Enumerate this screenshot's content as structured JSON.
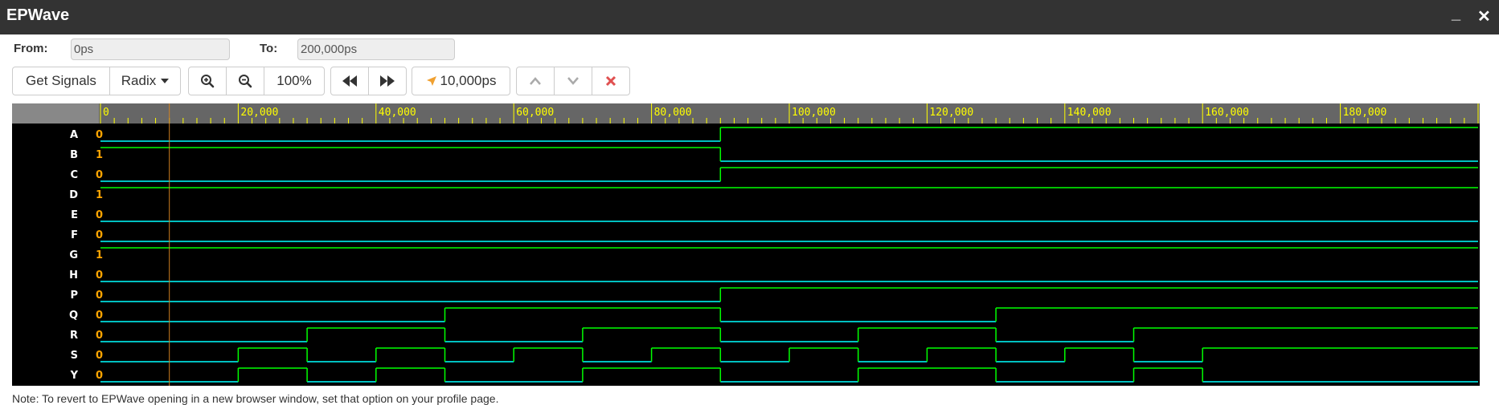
{
  "window": {
    "title": "EPWave",
    "minimize": "_",
    "close": "✕"
  },
  "range": {
    "from_label": "From:",
    "from_value": "0ps",
    "to_label": "To:",
    "to_value": "200,000ps"
  },
  "toolbar": {
    "get_signals": "Get Signals",
    "radix": "Radix",
    "zoom_level": "100%",
    "cursor_time": "10,000ps",
    "icons": [
      "zoom-in-icon",
      "zoom-out-icon",
      "rewind-icon",
      "fast-forward-icon",
      "cursor-arrow-icon",
      "chevron-up-icon",
      "chevron-down-icon",
      "remove-icon"
    ],
    "colors": {
      "cursor_arrow": "#f0a030",
      "remove": "#e05050"
    }
  },
  "timeline": {
    "total_ps": 200000,
    "labels": [
      "0",
      "20,000",
      "40,000",
      "60,000",
      "80,000",
      "100,000",
      "120,000",
      "140,000",
      "160,000",
      "180,000"
    ],
    "cursor_ps": 10000,
    "colors": {
      "ruler_bg": "#666666",
      "ruler_text": "#ffff00",
      "cursor": "#d08020",
      "wave": "#00ff00",
      "wave_low": "#00ffff"
    }
  },
  "signals": [
    {
      "name": "A",
      "value": "0",
      "wave": [
        [
          0,
          0
        ],
        [
          90000,
          1
        ]
      ]
    },
    {
      "name": "B",
      "value": "1",
      "wave": [
        [
          0,
          1
        ],
        [
          90000,
          0
        ]
      ]
    },
    {
      "name": "C",
      "value": "0",
      "wave": [
        [
          0,
          0
        ],
        [
          90000,
          1
        ]
      ]
    },
    {
      "name": "D",
      "value": "1",
      "wave": [
        [
          0,
          1
        ]
      ]
    },
    {
      "name": "E",
      "value": "0",
      "wave": [
        [
          0,
          0
        ]
      ]
    },
    {
      "name": "F",
      "value": "0",
      "wave": [
        [
          0,
          0
        ]
      ]
    },
    {
      "name": "G",
      "value": "1",
      "wave": [
        [
          0,
          1
        ]
      ]
    },
    {
      "name": "H",
      "value": "0",
      "wave": [
        [
          0,
          0
        ]
      ]
    },
    {
      "name": "P",
      "value": "0",
      "wave": [
        [
          0,
          0
        ],
        [
          90000,
          1
        ]
      ]
    },
    {
      "name": "Q",
      "value": "0",
      "wave": [
        [
          0,
          0
        ],
        [
          50000,
          1
        ],
        [
          90000,
          0
        ],
        [
          130000,
          1
        ]
      ]
    },
    {
      "name": "R",
      "value": "0",
      "wave": [
        [
          0,
          0
        ],
        [
          30000,
          1
        ],
        [
          50000,
          0
        ],
        [
          70000,
          1
        ],
        [
          90000,
          0
        ],
        [
          110000,
          1
        ],
        [
          130000,
          0
        ],
        [
          150000,
          1
        ]
      ]
    },
    {
      "name": "S",
      "value": "0",
      "wave": [
        [
          0,
          0
        ],
        [
          20000,
          1
        ],
        [
          30000,
          0
        ],
        [
          40000,
          1
        ],
        [
          50000,
          0
        ],
        [
          60000,
          1
        ],
        [
          70000,
          0
        ],
        [
          80000,
          1
        ],
        [
          90000,
          0
        ],
        [
          100000,
          1
        ],
        [
          110000,
          0
        ],
        [
          120000,
          1
        ],
        [
          130000,
          0
        ],
        [
          140000,
          1
        ],
        [
          150000,
          0
        ],
        [
          160000,
          1
        ]
      ]
    },
    {
      "name": "Y",
      "value": "0",
      "wave": [
        [
          0,
          0
        ],
        [
          20000,
          1
        ],
        [
          30000,
          0
        ],
        [
          40000,
          1
        ],
        [
          50000,
          0
        ],
        [
          70000,
          1
        ],
        [
          90000,
          0
        ],
        [
          110000,
          1
        ],
        [
          130000,
          0
        ],
        [
          150000,
          1
        ],
        [
          160000,
          0
        ]
      ]
    }
  ],
  "footer": {
    "note": "Note: To revert to EPWave opening in a new browser window, set that option on your profile page."
  }
}
